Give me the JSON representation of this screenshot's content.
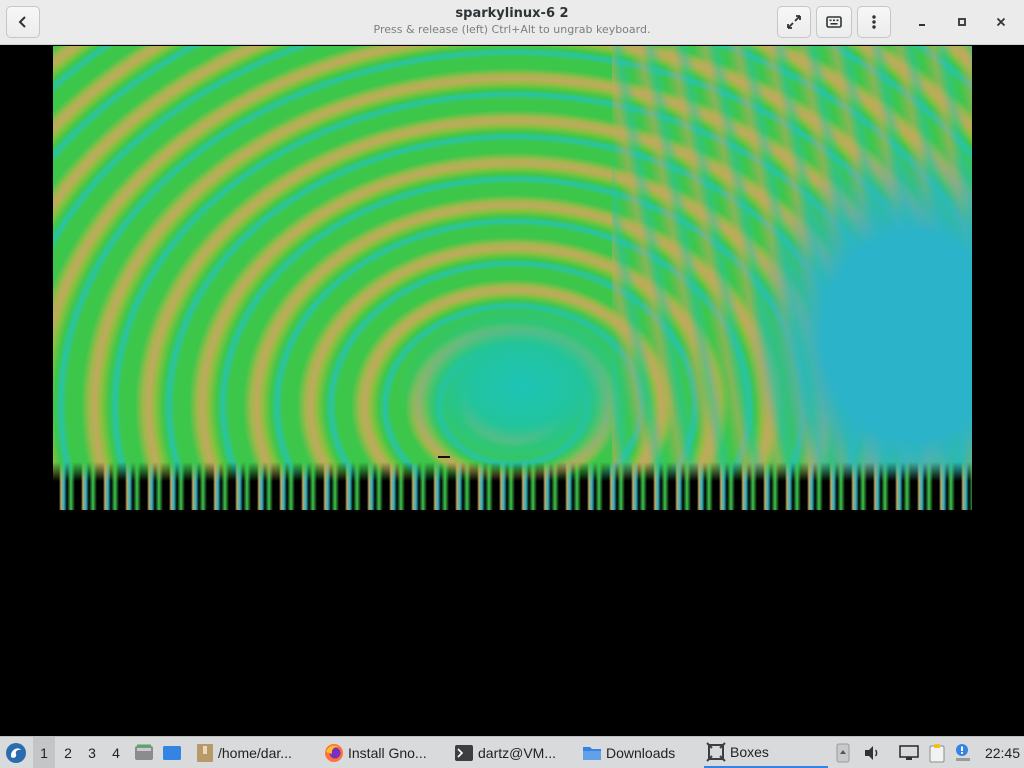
{
  "window": {
    "title": "sparkylinux-6 2",
    "subtitle": "Press & release (left) Ctrl+Alt to ungrab keyboard."
  },
  "headerbar": {
    "back_icon": "chevron-left-icon",
    "fullscreen_icon": "fullscreen-icon",
    "keyboard_icon": "keyboard-icon",
    "menu_icon": "vertical-dots-icon"
  },
  "vm_display": {
    "content": "fractal wallpaper",
    "colors": [
      "#3dc74a",
      "#28c3a8",
      "#c2a860",
      "#2bb3c9"
    ]
  },
  "taskbar": {
    "workspaces": [
      "1",
      "2",
      "3",
      "4"
    ],
    "active_workspace": "1",
    "tasks": [
      {
        "label": "/home/dar...",
        "icon": "archive-icon"
      },
      {
        "label": "Install Gno...",
        "icon": "firefox-icon"
      },
      {
        "label": "dartz@VM...",
        "icon": "terminal-icon"
      },
      {
        "label": "Downloads",
        "icon": "folder-icon"
      },
      {
        "label": "Boxes",
        "icon": "boxes-icon"
      }
    ],
    "active_task": "Boxes",
    "clock": "22:45"
  }
}
